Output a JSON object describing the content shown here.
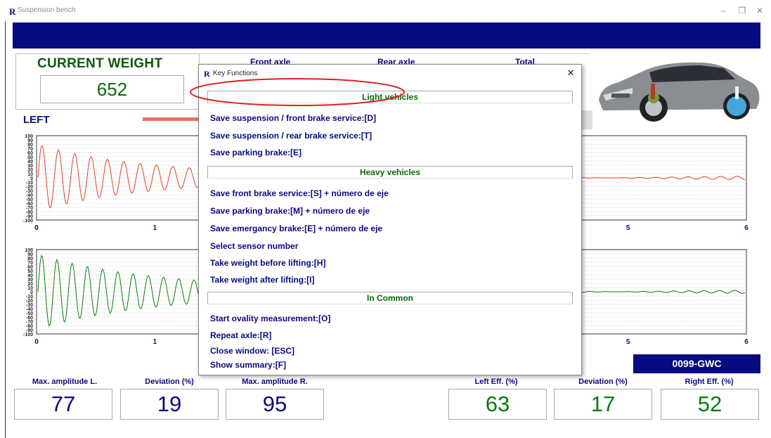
{
  "window": {
    "app_logo": "R",
    "title": "Suspension bench",
    "minimize_glyph": "–",
    "restore_glyph": "❐",
    "close_glyph": "✕"
  },
  "header": {
    "current_weight_title": "CURRENT WEIGHT",
    "current_weight_value": "652",
    "front_axle": "Front axle",
    "rear_axle": "Rear axle",
    "total": "Total",
    "side_label": "LEFT"
  },
  "charts": {
    "top": {
      "y_ticks": [
        "100",
        "90",
        "80",
        "70",
        "60",
        "50",
        "40",
        "30",
        "20",
        "10",
        "0",
        "-10",
        "-20",
        "-30",
        "-40",
        "-50",
        "-60",
        "-70",
        "-80",
        "-90",
        "-100"
      ],
      "x_ticks_visible": [
        "0",
        "1",
        "5",
        "6"
      ],
      "color": "#e0402a"
    },
    "bottom": {
      "y_ticks": [
        "100",
        "90",
        "80",
        "70",
        "60",
        "50",
        "40",
        "30",
        "20",
        "10",
        "0",
        "-10",
        "-20",
        "-30",
        "-40",
        "-50",
        "-60",
        "-70",
        "-80",
        "-90",
        "-100"
      ],
      "x_ticks_visible": [
        "0",
        "1",
        "5",
        "6"
      ],
      "color": "#0b7a0b"
    }
  },
  "dialog": {
    "logo": "R",
    "title": "Key Functions",
    "close_glyph": "✕",
    "light_vehicles": "Light vehicles",
    "light_items": [
      "Save suspension / front brake service:[D]",
      "Save suspension / rear brake service:[T]",
      "Save parking brake:[E]"
    ],
    "heavy_vehicles": "Heavy vehicles",
    "heavy_items": [
      "Save front brake service:[S] + número de eje",
      "Save parking brake:[M] + número de eje",
      "Save emergancy brake:[E] + número de eje",
      "Select sensor number",
      "Take weight before lifting:[H]",
      "Take weight after lifting:[I]"
    ],
    "in_common": "In Common",
    "common_items": [
      "Start ovality measurement:[O]",
      "Repeat axle:[R]",
      "Close window: [ESC]",
      "Show summary:[F]"
    ]
  },
  "plate": "0099-GWC",
  "metrics": {
    "max_amp_l_label": "Max. amplitude L.",
    "max_amp_l": "77",
    "deviation_l_label": "Deviation (%)",
    "deviation_l": "19",
    "max_amp_r_label": "Max. amplitude R.",
    "max_amp_r": "95",
    "left_eff_label": "Left Eff. (%)",
    "left_eff": "63",
    "deviation_r_label": "Deviation (%)",
    "deviation_r": "17",
    "right_eff_label": "Right Eff. (%)",
    "right_eff": "52"
  }
}
